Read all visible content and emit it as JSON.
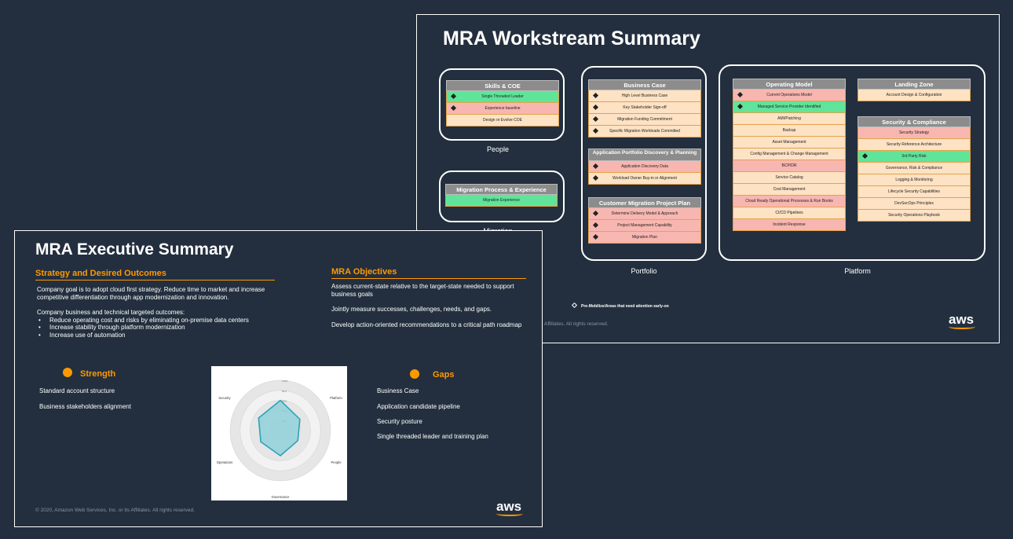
{
  "workstream": {
    "title": "MRA Workstream Summary",
    "people": {
      "label": "People",
      "skills": {
        "title": "Skills & COE",
        "items": [
          {
            "text": "Single Threaded Leader",
            "status": "green",
            "flag": true
          },
          {
            "text": "Experience baseline",
            "status": "red",
            "flag": true
          },
          {
            "text": "Design or Evolve COE",
            "status": "neutral",
            "flag": false
          }
        ]
      }
    },
    "migration": {
      "label": "Migration",
      "panel": {
        "title": "Migration Process & Experience",
        "items": [
          {
            "text": "Migration Experience",
            "status": "green",
            "flag": false
          }
        ]
      }
    },
    "portfolio": {
      "label": "Portfolio",
      "business_case": {
        "title": "Business Case",
        "items": [
          {
            "text": "High Level Business Case",
            "status": "neutral",
            "flag": true
          },
          {
            "text": "Key Stakeholder Sign-off",
            "status": "neutral",
            "flag": true
          },
          {
            "text": "Migration Funding Commitment",
            "status": "neutral",
            "flag": true
          },
          {
            "text": "Specific Migration Workloads Committed",
            "status": "neutral",
            "flag": true
          }
        ]
      },
      "discovery": {
        "title": "Application Portfolio Discovery & Planning",
        "items": [
          {
            "text": "Application Discovery Data",
            "status": "red",
            "flag": true
          },
          {
            "text": "Workload Owner Buy-in or Alignment",
            "status": "neutral",
            "flag": true
          }
        ]
      },
      "project_plan": {
        "title": "Customer Migration Project Plan",
        "items": [
          {
            "text": "Determine Delivery Model & Approach",
            "status": "red",
            "flag": true
          },
          {
            "text": "Project Management Capability",
            "status": "red",
            "flag": true
          },
          {
            "text": "Migration Plan",
            "status": "red",
            "flag": true
          }
        ]
      }
    },
    "platform": {
      "label": "Platform",
      "operating_model": {
        "title": "Operating Model",
        "items": [
          {
            "text": "Current Operations Model",
            "status": "red",
            "flag": true
          },
          {
            "text": "Managed Service Provider Identified",
            "status": "green",
            "flag": true
          },
          {
            "text": "AMI/Patching",
            "status": "neutral",
            "flag": false
          },
          {
            "text": "Backup",
            "status": "neutral",
            "flag": false
          },
          {
            "text": "Asset Management",
            "status": "neutral",
            "flag": false
          },
          {
            "text": "Config Management & Change Management",
            "status": "neutral",
            "flag": false
          },
          {
            "text": "BCP/DR",
            "status": "red",
            "flag": false
          },
          {
            "text": "Service Catalog",
            "status": "neutral",
            "flag": false
          },
          {
            "text": "Cost Management",
            "status": "neutral",
            "flag": false
          },
          {
            "text": "Cloud Ready Operational Processes & Run Books",
            "status": "red",
            "flag": false
          },
          {
            "text": "CI/CD Pipelines",
            "status": "neutral",
            "flag": false
          },
          {
            "text": "Incident Response",
            "status": "red",
            "flag": false
          }
        ]
      },
      "landing_zone": {
        "title": "Landing Zone",
        "items": [
          {
            "text": "Account Design & Configuration",
            "status": "neutral",
            "flag": false
          }
        ]
      },
      "security": {
        "title": "Security & Compliance",
        "items": [
          {
            "text": "Security Strategy",
            "status": "red",
            "flag": false
          },
          {
            "text": "Security Reference Architecture",
            "status": "neutral",
            "flag": false
          },
          {
            "text": "3rd Party Risk",
            "status": "green",
            "flag": true
          },
          {
            "text": "Governance, Risk & Compliance",
            "status": "neutral",
            "flag": false
          },
          {
            "text": "Logging & Monitoring",
            "status": "neutral",
            "flag": false
          },
          {
            "text": "Lifecycle Security Capabilities",
            "status": "neutral",
            "flag": false
          },
          {
            "text": "DevSecOps Principles",
            "status": "neutral",
            "flag": false
          },
          {
            "text": "Security Operations Playbook",
            "status": "neutral",
            "flag": false
          }
        ]
      }
    },
    "legend": "Pre-Mobilize/Areas that need attention early-on",
    "copyright_fragment": "Affiliates. All rights reserved.",
    "logo": "aws"
  },
  "executive": {
    "title": "MRA Executive Summary",
    "strategy": {
      "heading": "Strategy and Desired Outcomes",
      "goal": "Company goal is to adopt cloud first strategy. Reduce time to market and increase competitive differentiation through app modernization and innovation.",
      "outcomes_intro": "Company business and technical targeted outcomes:",
      "outcomes": [
        "Reduce operating cost and risks by eliminating on-premise data centers",
        "Increase stability through platform modernization",
        "Increase use of automation"
      ]
    },
    "objectives": {
      "heading": "MRA Objectives",
      "items": [
        "Assess current-state relative to the target-state needed to support business goals",
        "Jointly measure successes, challenges, needs, and gaps.",
        "Develop action-oriented recommendations to a critical path roadmap"
      ]
    },
    "strength": {
      "heading": "Strength",
      "items": [
        "Standard account structure",
        "Business stakeholders alignment"
      ]
    },
    "gaps": {
      "heading": "Gaps",
      "items": [
        "Business Case",
        "Application candidate pipeline",
        "Security posture",
        "Single threaded leader and training plan"
      ]
    },
    "copyright": "© 2020, Amazon Web Services, Inc. or its Affiliates. All rights reserved.",
    "logo": "aws"
  },
  "chart_data": {
    "type": "radar",
    "categories": [
      "Business",
      "Platform",
      "People",
      "Governance",
      "Operations",
      "Security"
    ],
    "values": [
      60,
      45,
      40,
      50,
      45,
      50
    ],
    "rlim": [
      0,
      100
    ],
    "tick_labels": [
      "20%",
      "40%",
      "60%",
      "80%",
      "100%"
    ],
    "grid": true,
    "colors": {
      "fill": "#8fd0d8",
      "stroke": "#2aa3b5"
    }
  },
  "colors": {
    "background": "#232f3e",
    "accent": "#ff9900",
    "red": "#f8b6b1",
    "green": "#5fe49a",
    "neutral": "#fde2c4"
  }
}
